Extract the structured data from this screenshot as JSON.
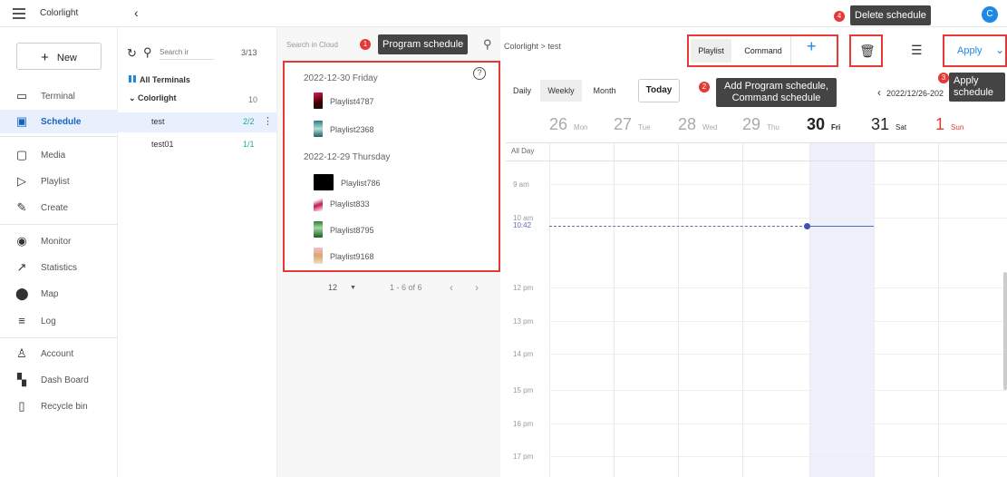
{
  "app": {
    "brand": "Colorlight",
    "avatar_letter": "C"
  },
  "nav": {
    "new_label": "New",
    "items": [
      {
        "label": "Terminal",
        "icon": "terminal-icon"
      },
      {
        "label": "Schedule",
        "icon": "schedule-icon"
      },
      {
        "label": "Media",
        "icon": "media-icon"
      },
      {
        "label": "Playlist",
        "icon": "playlist-icon"
      },
      {
        "label": "Create",
        "icon": "pencil-icon"
      },
      {
        "label": "Monitor",
        "icon": "eye-icon"
      },
      {
        "label": "Statistics",
        "icon": "trend-icon"
      },
      {
        "label": "Map",
        "icon": "map-pin-icon"
      },
      {
        "label": "Log",
        "icon": "log-icon"
      },
      {
        "label": "Account",
        "icon": "account-icon"
      },
      {
        "label": "Dash Board",
        "icon": "dashboard-icon"
      },
      {
        "label": "Recycle bin",
        "icon": "trash-icon"
      }
    ],
    "active": "Schedule"
  },
  "tree": {
    "search_placeholder": "Search ir",
    "count": "3/13",
    "all_terminals": "All Terminals",
    "group": "Colorlight",
    "group_count": "10",
    "rows": [
      {
        "name": "test",
        "count": "2/2"
      },
      {
        "name": "test01",
        "count": "1/1"
      }
    ]
  },
  "cloud": {
    "search_placeholder": "Search in Cloud",
    "sections": [
      {
        "date": "2022-12-30 Friday",
        "playlists": [
          "Playlist4787",
          "Playlist2368"
        ]
      },
      {
        "date": "2022-12-29 Thursday",
        "playlists": [
          "Playlist786",
          "Playlist833",
          "Playlist8795",
          "Playlist9168"
        ]
      }
    ],
    "pager": {
      "per_page": "12",
      "range": "1 - 6 of 6"
    }
  },
  "callouts": {
    "c1": {
      "num": "1",
      "text": "Program schedule"
    },
    "c2": {
      "num": "2",
      "line1": "Add Program schedule,",
      "line2": "Command schedule"
    },
    "c3": {
      "num": "3",
      "line1": "Apply",
      "line2": "schedule"
    },
    "c4": {
      "num": "4",
      "text": "Delete schedule"
    }
  },
  "main": {
    "breadcrumb_root": "Colorlight",
    "breadcrumb_sep": ">",
    "breadcrumb_leaf": "test",
    "tabs": {
      "playlist": "Playlist",
      "command": "Command"
    },
    "apply": "Apply",
    "views": [
      "Daily",
      "Weekly",
      "Month"
    ],
    "today": "Today",
    "date_range": "2022/12/26-202",
    "days": [
      {
        "num": "26",
        "name": "Mon"
      },
      {
        "num": "27",
        "name": "Tue"
      },
      {
        "num": "28",
        "name": "Wed"
      },
      {
        "num": "29",
        "name": "Thu"
      },
      {
        "num": "30",
        "name": "Fri"
      },
      {
        "num": "31",
        "name": "Sat"
      },
      {
        "num": "1",
        "name": "Sun"
      }
    ],
    "all_day": "All Day",
    "hours": [
      "9 am",
      "10 am",
      "12 pm",
      "13 pm",
      "14 pm",
      "15 pm",
      "16 pm",
      "17 pm"
    ],
    "now": "10:42"
  },
  "colors": {
    "accent": "#1e88e5",
    "highlight": "#e53935",
    "active_bg": "#e8f0fe"
  }
}
